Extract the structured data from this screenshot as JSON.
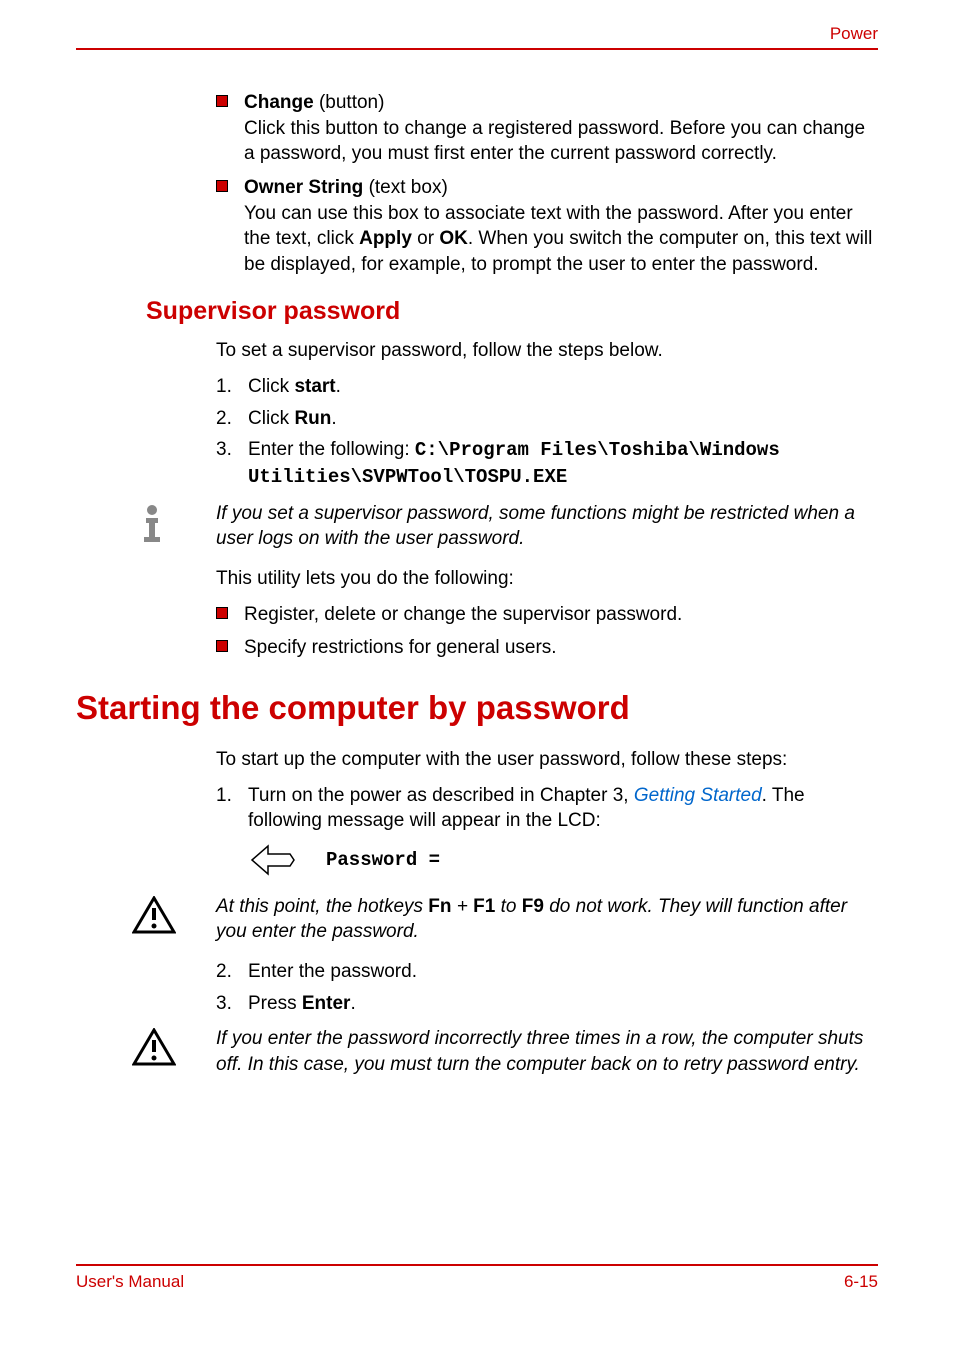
{
  "header": {
    "section": "Power"
  },
  "bullets_top": [
    {
      "title": "Change",
      "qualifier": " (button)",
      "body": "Click this button to change a registered password. Before you can change a password, you must first enter the current password correctly."
    },
    {
      "title": "Owner String",
      "qualifier": " (text box)",
      "body_pre": "You can use this box to associate text with the password. After you enter the text, click ",
      "apply": "Apply",
      "or": " or ",
      "ok": "OK",
      "body_post": ". When you switch the computer on, this text will be displayed, for example, to prompt the user to enter the password."
    }
  ],
  "supervisor": {
    "heading": "Supervisor password",
    "intro": "To set a supervisor password, follow the steps below.",
    "steps": [
      {
        "num": "1.",
        "pre": "Click ",
        "bold": "start",
        "post": "."
      },
      {
        "num": "2.",
        "pre": "Click ",
        "bold": "Run",
        "post": "."
      },
      {
        "num": "3.",
        "pre": "Enter the following: ",
        "mono": "C:\\Program Files\\Toshiba\\Windows Utilities\\SVPWTool\\TOSPU.EXE"
      }
    ],
    "note": "If you set a supervisor password, some functions might be restricted when a user logs on with the user password.",
    "after": "This utility lets you do the following:",
    "sub_bullets": [
      "Register, delete or change the supervisor password.",
      "Specify restrictions for general users."
    ]
  },
  "starting": {
    "heading": "Starting the computer by password",
    "intro": "To start up the computer with the user password, follow these steps:",
    "step1": {
      "num": "1.",
      "pre": "Turn on the power as described in Chapter 3, ",
      "link": "Getting Started",
      "post": ". The following message will appear in the LCD:"
    },
    "password_label": "Password =",
    "warn1_pre": "At this point, the hotkeys ",
    "warn1_fn": "Fn",
    "warn1_plus": " + ",
    "warn1_f1": "F1",
    "warn1_to": " to ",
    "warn1_f9": "F9",
    "warn1_post": " do not work. They will function after you enter the password.",
    "step2": {
      "num": "2.",
      "text": "Enter the password."
    },
    "step3": {
      "num": "3.",
      "pre": "Press ",
      "bold": "Enter",
      "post": "."
    },
    "warn2": "If you enter the password incorrectly three times in a row, the computer shuts off. In this case, you must turn the computer back on to retry password entry."
  },
  "footer": {
    "left": "User's Manual",
    "right": "6-15"
  }
}
